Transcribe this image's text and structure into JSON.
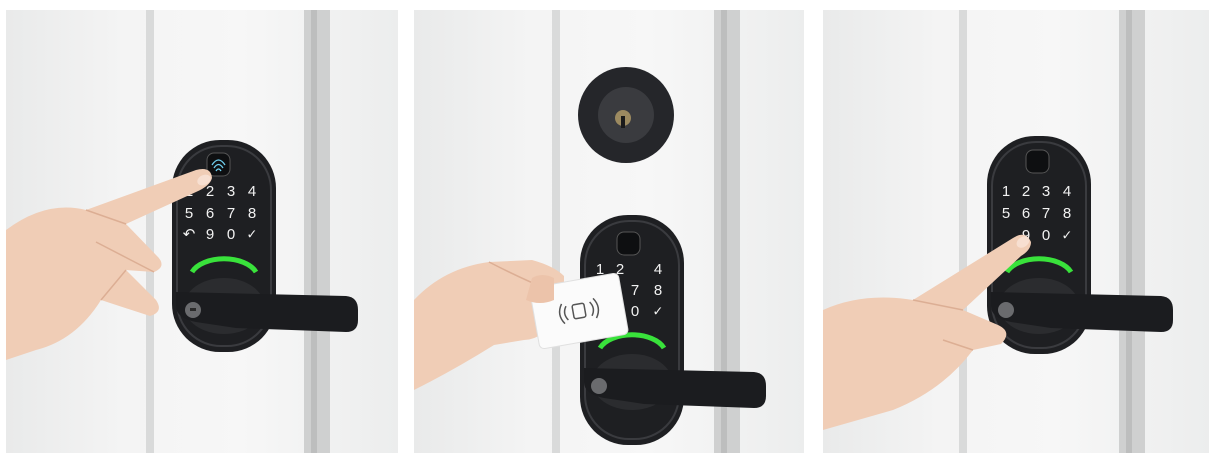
{
  "panels": [
    {
      "id": "fingerprint",
      "keypad": {
        "rows": [
          [
            "1",
            "2",
            "3",
            "4"
          ],
          [
            "5",
            "6",
            "7",
            "8"
          ],
          [
            "↶",
            "9",
            "0",
            "✓"
          ]
        ]
      }
    },
    {
      "id": "card",
      "keypad": {
        "rows": [
          [
            "1",
            "2",
            "4"
          ],
          [
            "7",
            "8"
          ],
          [
            "0",
            "✓"
          ]
        ]
      }
    },
    {
      "id": "code",
      "keypad": {
        "rows": [
          [
            "1",
            "2",
            "3",
            "4"
          ],
          [
            "5",
            "6",
            "7",
            "8"
          ],
          [
            "9",
            "0",
            "✓"
          ]
        ]
      }
    }
  ],
  "colors": {
    "lock_body": "#1e1f22",
    "lock_ring": "#2b2c2f",
    "status_light": "#39e23b",
    "skin": "#f0cdb6",
    "door": "#f4f4f4",
    "card": "#fbfbfb"
  },
  "icons": [
    "fingerprint-sensor-icon",
    "nfc-card-icon",
    "deadbolt-keyhole-icon"
  ]
}
